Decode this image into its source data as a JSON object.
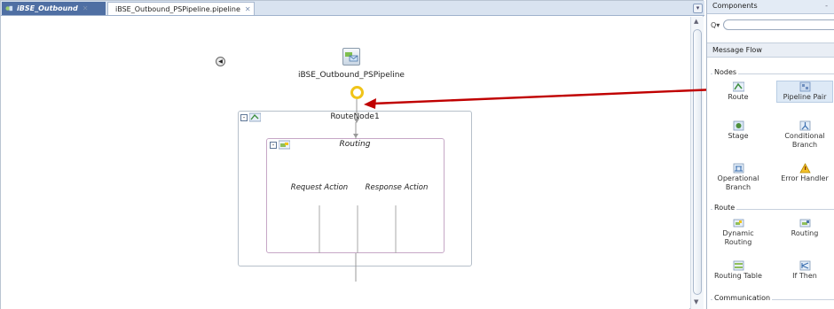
{
  "tabs": [
    {
      "label": "iBSE_Outbound"
    },
    {
      "label": "iBSE_Outbound_PSPipeline.pipeline"
    }
  ],
  "canvas": {
    "pipeline_label": "iBSE_Outbound_PSPipeline",
    "route_node_label": "RouteNode1",
    "routing_label": "Routing",
    "request_action_label": "Request Action",
    "response_action_label": "Response Action"
  },
  "palette": {
    "title": "Components",
    "search": {
      "value": "",
      "prefix": "Q▾"
    },
    "selected_page": "Message Flow",
    "sections": [
      {
        "name": "Nodes",
        "items": [
          "Route",
          "Pipeline Pair",
          "Stage",
          "Conditional Branch",
          "Operational Branch",
          "Error Handler"
        ]
      },
      {
        "name": "Route",
        "items": [
          "Dynamic Routing",
          "Routing",
          "Routing Table",
          "If Then"
        ]
      },
      {
        "name": "Communication",
        "items": []
      }
    ]
  },
  "colors": {
    "arrow": "#c00000",
    "active_tab": "#4f6fa3",
    "start_ring": "#f0c419",
    "highlight": "#dde9f6"
  },
  "icons": {
    "collapse": "◀",
    "close": "✕",
    "minimize": "-"
  }
}
